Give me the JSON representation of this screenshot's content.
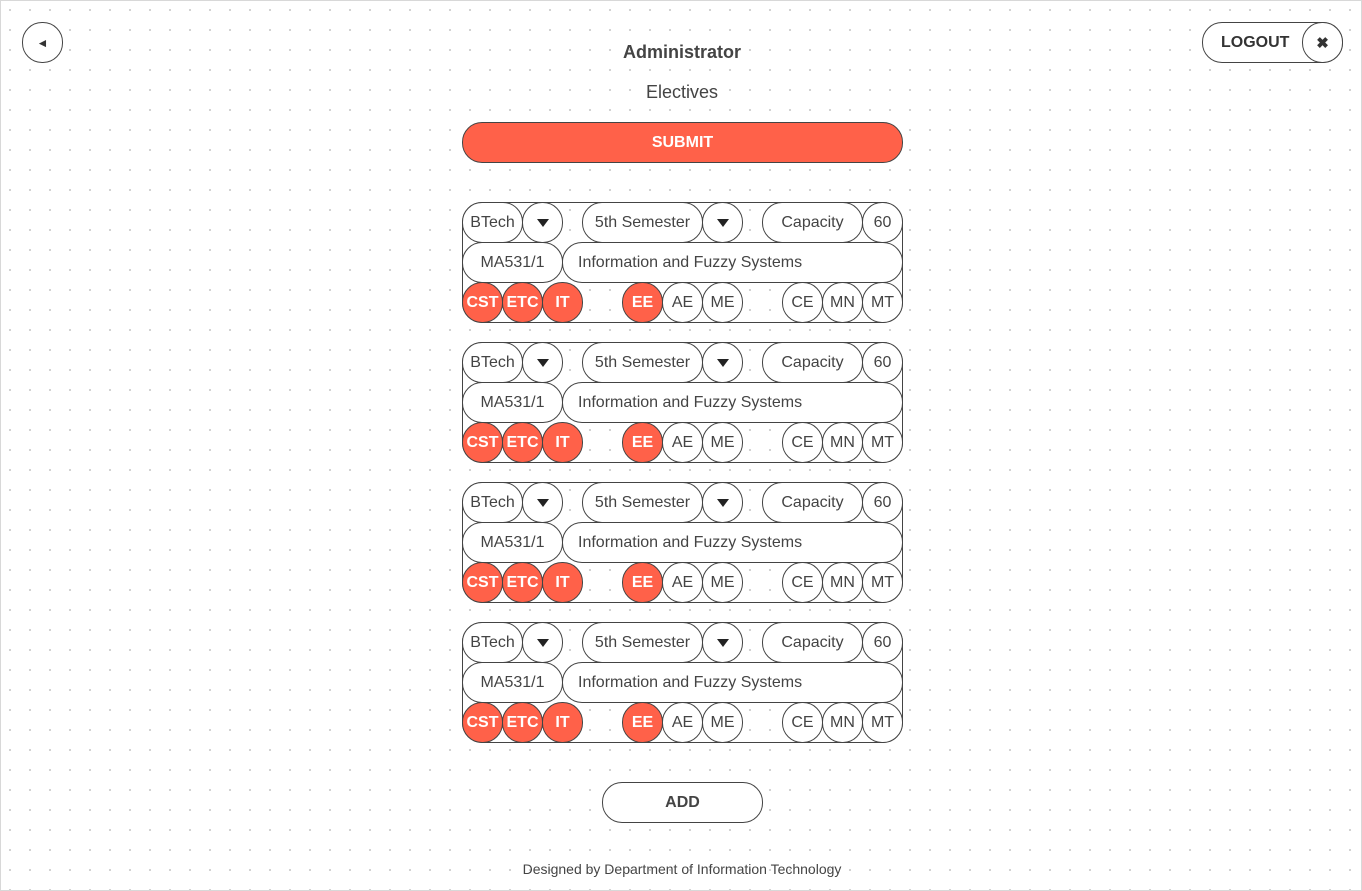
{
  "header": {
    "back_icon": "◄",
    "title": "Administrator",
    "subtitle": "Electives",
    "logout_label": "LOGOUT",
    "close_icon": "✖"
  },
  "submit_label": "SUBMIT",
  "add_label": "ADD",
  "footer": "Designed by Department of Information Technology",
  "accent_color": "#ff6149",
  "electives": [
    {
      "program": "BTech",
      "semester": "5th Semester",
      "capacity_label": "Capacity",
      "capacity": "60",
      "code": "MA531/1",
      "name": "Information and Fuzzy Systems",
      "departments": [
        {
          "label": "CST",
          "selected": true
        },
        {
          "label": "ETC",
          "selected": true
        },
        {
          "label": "IT",
          "selected": true
        },
        {
          "label": "EE",
          "selected": true
        },
        {
          "label": "AE",
          "selected": false
        },
        {
          "label": "ME",
          "selected": false
        },
        {
          "label": "CE",
          "selected": false
        },
        {
          "label": "MN",
          "selected": false
        },
        {
          "label": "MT",
          "selected": false
        }
      ]
    },
    {
      "program": "BTech",
      "semester": "5th Semester",
      "capacity_label": "Capacity",
      "capacity": "60",
      "code": "MA531/1",
      "name": "Information and Fuzzy Systems",
      "departments": [
        {
          "label": "CST",
          "selected": true
        },
        {
          "label": "ETC",
          "selected": true
        },
        {
          "label": "IT",
          "selected": true
        },
        {
          "label": "EE",
          "selected": true
        },
        {
          "label": "AE",
          "selected": false
        },
        {
          "label": "ME",
          "selected": false
        },
        {
          "label": "CE",
          "selected": false
        },
        {
          "label": "MN",
          "selected": false
        },
        {
          "label": "MT",
          "selected": false
        }
      ]
    },
    {
      "program": "BTech",
      "semester": "5th Semester",
      "capacity_label": "Capacity",
      "capacity": "60",
      "code": "MA531/1",
      "name": "Information and Fuzzy Systems",
      "departments": [
        {
          "label": "CST",
          "selected": true
        },
        {
          "label": "ETC",
          "selected": true
        },
        {
          "label": "IT",
          "selected": true
        },
        {
          "label": "EE",
          "selected": true
        },
        {
          "label": "AE",
          "selected": false
        },
        {
          "label": "ME",
          "selected": false
        },
        {
          "label": "CE",
          "selected": false
        },
        {
          "label": "MN",
          "selected": false
        },
        {
          "label": "MT",
          "selected": false
        }
      ]
    },
    {
      "program": "BTech",
      "semester": "5th Semester",
      "capacity_label": "Capacity",
      "capacity": "60",
      "code": "MA531/1",
      "name": "Information and Fuzzy Systems",
      "departments": [
        {
          "label": "CST",
          "selected": true
        },
        {
          "label": "ETC",
          "selected": true
        },
        {
          "label": "IT",
          "selected": true
        },
        {
          "label": "EE",
          "selected": true
        },
        {
          "label": "AE",
          "selected": false
        },
        {
          "label": "ME",
          "selected": false
        },
        {
          "label": "CE",
          "selected": false
        },
        {
          "label": "MN",
          "selected": false
        },
        {
          "label": "MT",
          "selected": false
        }
      ]
    }
  ]
}
